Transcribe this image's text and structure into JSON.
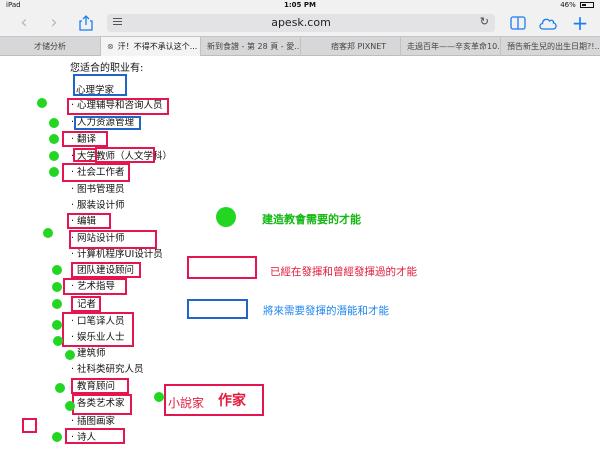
{
  "status_bar": {
    "device": "iPad",
    "time": "1:05 PM",
    "battery": "46%"
  },
  "toolbar": {
    "url": "apesk.com"
  },
  "tabs": [
    {
      "label": "才储分析",
      "active": false
    },
    {
      "label": "汗！不得不承认这个...",
      "active": true
    },
    {
      "label": "新到食譜 - 第 28 頁 - 愛...",
      "active": false
    },
    {
      "label": "痞客邦 PIXNET",
      "active": false
    },
    {
      "label": "走過百年——辛亥革命10...",
      "active": false
    },
    {
      "label": "預告新生兒的出生日期?!...",
      "active": false
    }
  ],
  "content": {
    "heading": "您适合的职业有:",
    "jobs": [
      "心理学家",
      "· 心理辅导和咨询人员",
      "· 人力资源管理",
      "· 翻译",
      "· 大学教师（人文学科）",
      "· 社会工作者",
      "· 图书管理员",
      "· 服装设计师",
      "· 编辑",
      "· 网站设计师",
      "· 计算机程序UI设计员",
      "· 团队建设顾问",
      "· 艺术指导",
      "· 记者",
      "· 口笔译人员",
      "· 娱乐业人士",
      "· 建筑师",
      "· 社科类研究人员",
      "· 教育顾问",
      "· 各类艺术家",
      "· 插图画家",
      "· 诗人"
    ]
  },
  "legend": {
    "green": "建造教會需要的才能",
    "red": "已經在發揮和曾經發揮過的才能",
    "blue": "將來需要發揮的潛能和才能"
  },
  "note": {
    "small": "小說家",
    "large": "作家"
  },
  "colors": {
    "green": "#22d622",
    "red": "#e4154f",
    "blue": "#1f66c7"
  }
}
